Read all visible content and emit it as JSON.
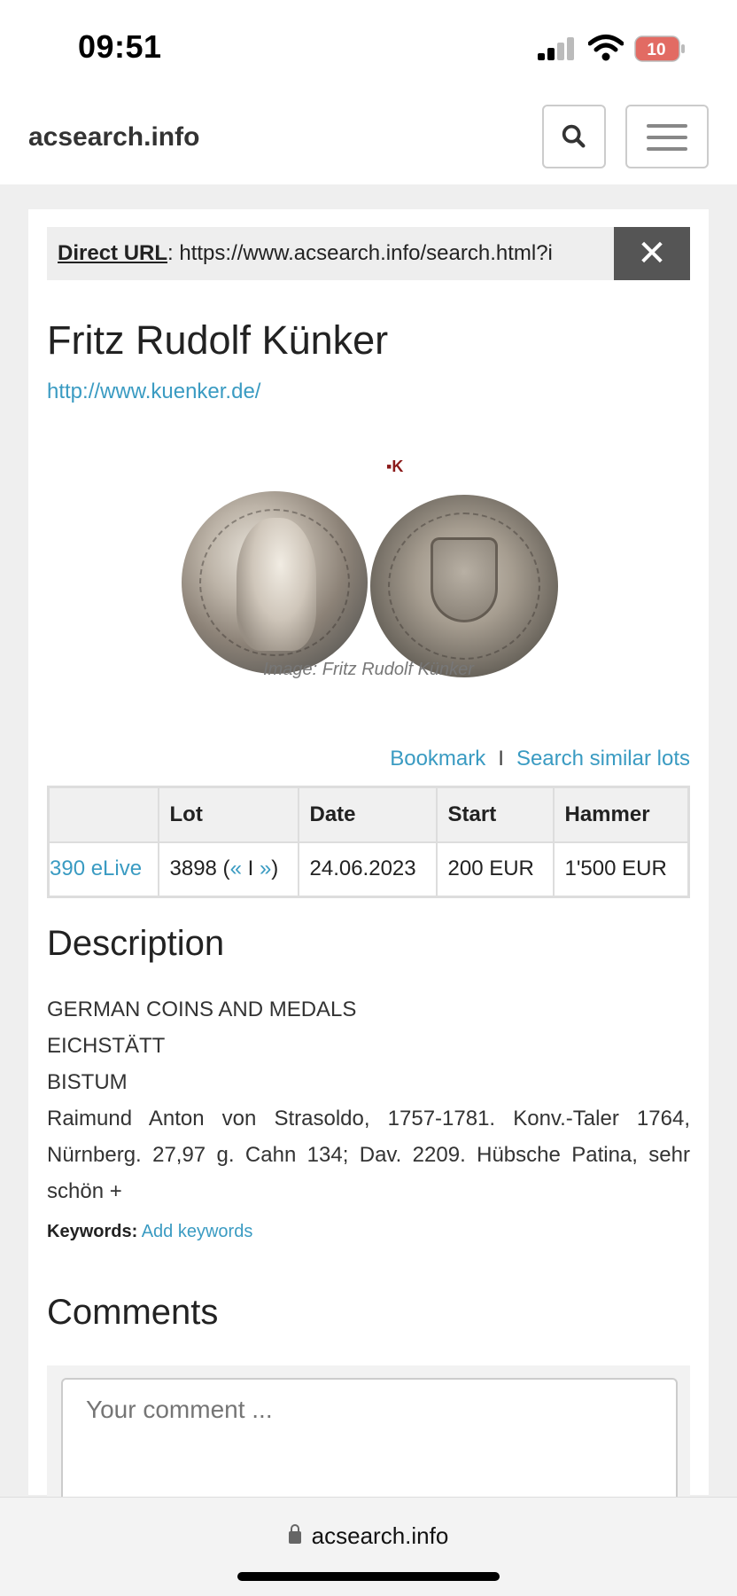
{
  "status_bar": {
    "time": "09:51",
    "battery": "10"
  },
  "navbar": {
    "site_name": "acsearch.info"
  },
  "direct_url": {
    "label": "Direct URL",
    "colon": ":",
    "value": "https://www.acsearch.info/search.html?i",
    "close_symbol": "✕"
  },
  "auction_house": {
    "name": "Fritz Rudolf Künker",
    "url": "http://www.kuenker.de/"
  },
  "image": {
    "mark": "▪K",
    "caption": "Image: Fritz Rudolf Künker"
  },
  "actions": {
    "bookmark": "Bookmark",
    "separator": "I",
    "search_similar": "Search similar lots"
  },
  "lot_table": {
    "headers": [
      "",
      "Lot",
      "Date",
      "Start",
      "Hammer"
    ],
    "row": {
      "auction": "390 eLive",
      "lot_number": "3898 (",
      "prev": "«",
      "mid": " I ",
      "next": "»",
      "lot_close": ")",
      "date": "24.06.2023",
      "start": "200 EUR",
      "hammer": "1'500 EUR"
    }
  },
  "description": {
    "heading": "Description",
    "lines": [
      "GERMAN COINS AND MEDALS",
      "EICHSTÄTT",
      "BISTUM"
    ],
    "body": "Raimund Anton von Strasoldo, 1757-1781. Konv.-Taler 1764, Nürnberg. 27,97 g. Cahn 134; Dav. 2209. Hübsche Patina, sehr schön +",
    "keywords_label": "Keywords:",
    "keywords_link": "Add keywords"
  },
  "comments": {
    "heading": "Comments",
    "placeholder": "Your comment ..."
  },
  "browser": {
    "address": "acsearch.info"
  }
}
